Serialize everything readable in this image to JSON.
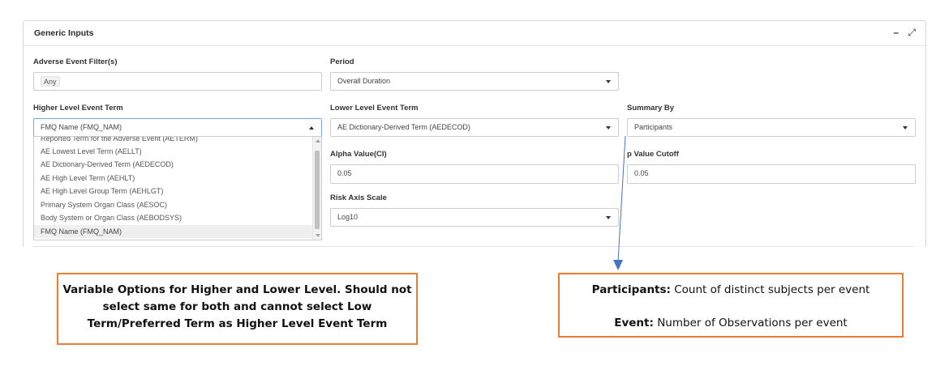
{
  "panel": {
    "title": "Generic Inputs",
    "minimize_glyph": "–",
    "expand_glyph": "⤢"
  },
  "fields": {
    "ae_filter": {
      "label": "Adverse Event Filter(s)",
      "value": "Any"
    },
    "period": {
      "label": "Period",
      "value": "Overall Duration"
    },
    "higher_level": {
      "label": "Higher Level Event Term",
      "value": "FMQ Name (FMQ_NAM)"
    },
    "lower_level": {
      "label": "Lower Level Event Term",
      "value": "AE Dictionary-Derived Term (AEDECOD)"
    },
    "summary_by": {
      "label": "Summary By",
      "value": "Participants"
    },
    "alpha": {
      "label": "Alpha Value(CI)",
      "value": "0.05"
    },
    "p_cutoff": {
      "label": "p Value Cutoff",
      "value": "0.05"
    },
    "risk_axis": {
      "label": "Risk Axis Scale",
      "value": "Log10"
    }
  },
  "dropdown": {
    "items": [
      "Reported Term for the Adverse Event (AETERM)",
      "AE Lowest Level Term (AELLT)",
      "AE Dictionary-Derived Term (AEDECOD)",
      "AE High Level Term (AEHLT)",
      "AE High Level Group Term (AEHLGT)",
      "Primary System Organ Class (AESOC)",
      "Body System or Organ Class (AEBODSYS)",
      "FMQ Name (FMQ_NAM)"
    ],
    "selected": "FMQ Name (FMQ_NAM)"
  },
  "annotations": {
    "left_note": "Variable Options for Higher and Lower Level. Should not select same for both and cannot select Low Term/Preferred Term as Higher Level Event Term",
    "right_note": {
      "participants_label": "Participants:",
      "participants_text": "Count of distinct subjects per event",
      "event_label": "Event:",
      "event_text": "Number of Observations per event"
    },
    "border_color": "#ed7d31",
    "arrow_color": "#4472c4"
  }
}
